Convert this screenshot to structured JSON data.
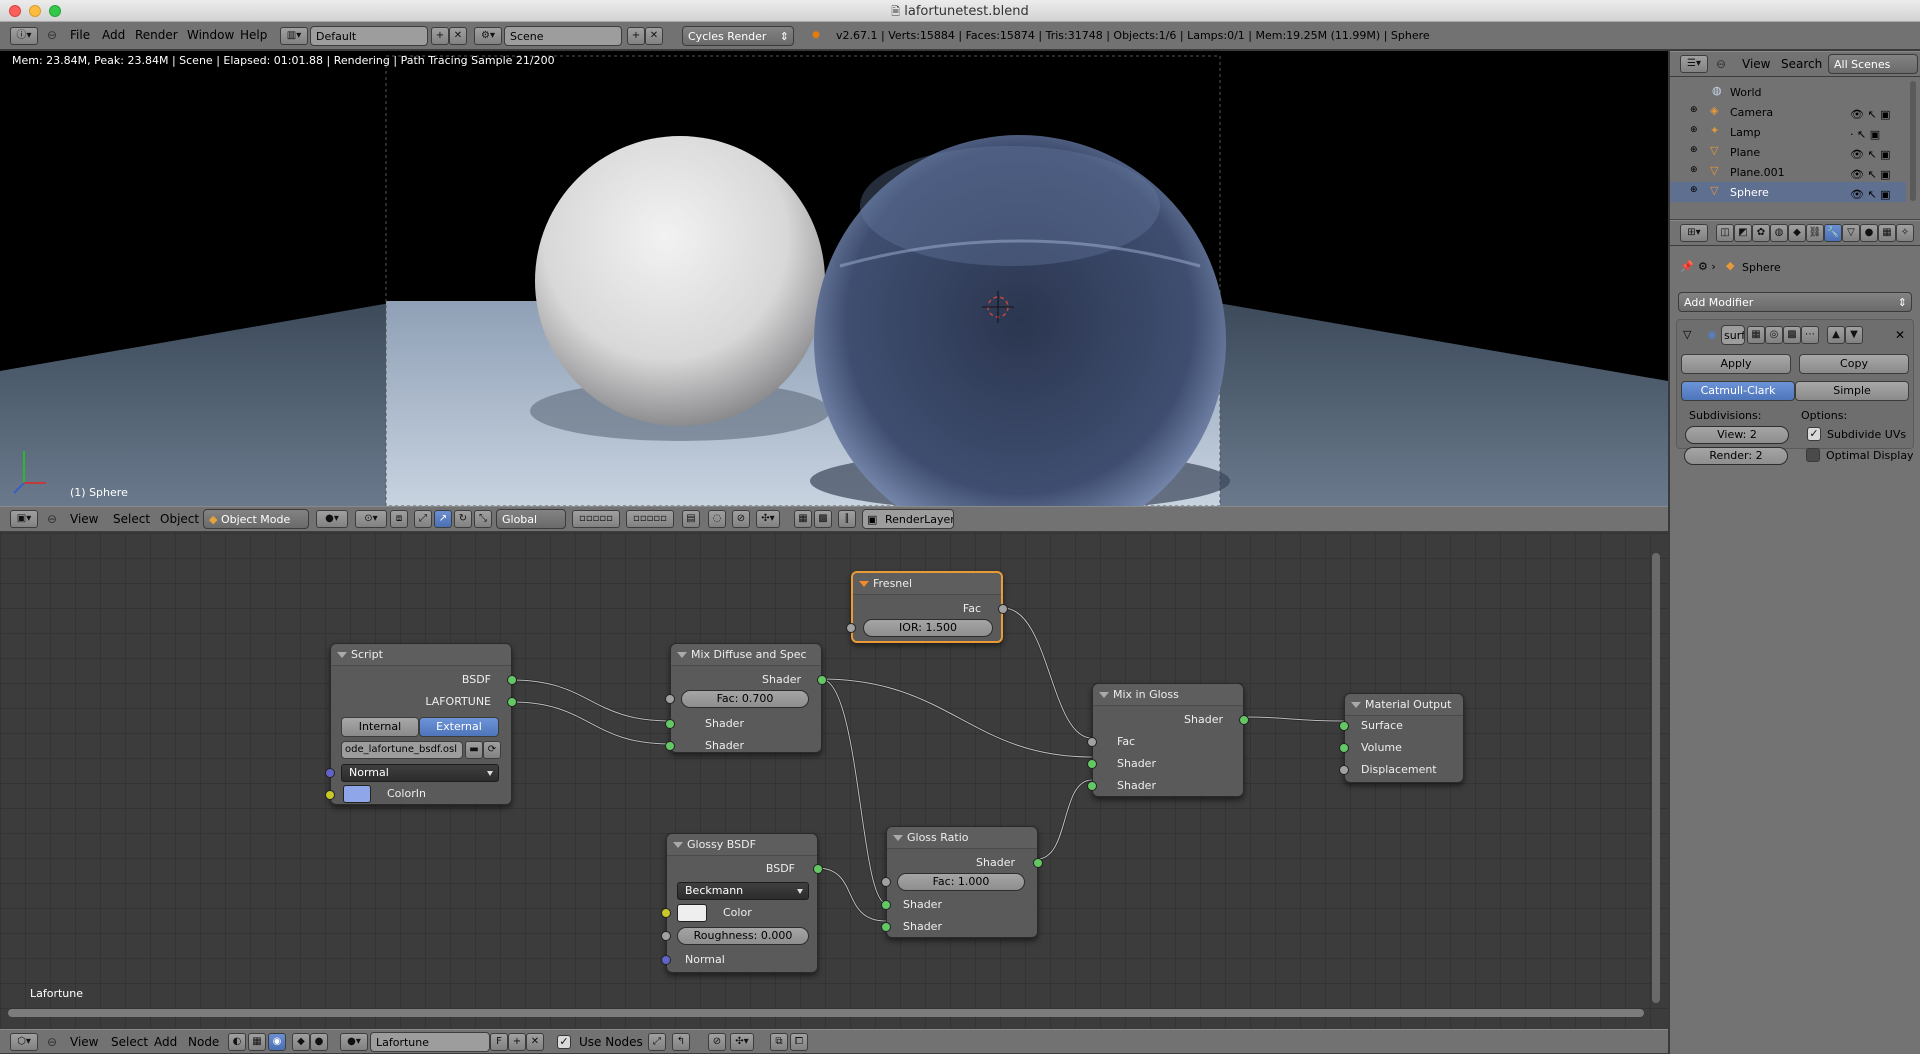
{
  "window": {
    "title": "lafortunetest.blend"
  },
  "info_bar": {
    "menus": [
      "File",
      "Add",
      "Render",
      "Window",
      "Help"
    ],
    "screen_layout": "Default",
    "scene": "Scene",
    "render_engine": "Cycles Render",
    "stats": "v2.67.1 | Verts:15884 | Faces:15874 | Tris:31748 | Objects:1/6 | Lamps:0/1 | Mem:19.25M (11.99M) | Sphere"
  },
  "viewport": {
    "render_status": "Mem: 23.84M, Peak: 23.84M | Scene | Elapsed: 01:01.88 | Rendering | Path Tracing Sample 21/200",
    "object_label": "(1) Sphere",
    "header": {
      "menus": [
        "View",
        "Select",
        "Object"
      ],
      "mode": "Object Mode",
      "orientation": "Global",
      "render_layer": "RenderLayer"
    }
  },
  "outliner": {
    "header": {
      "view": "View",
      "search": "Search",
      "scenes": "All Scenes"
    },
    "items": [
      {
        "name": "World",
        "icon": "world-icon"
      },
      {
        "name": "Camera",
        "icon": "camera-icon"
      },
      {
        "name": "Lamp",
        "icon": "lamp-icon"
      },
      {
        "name": "Plane",
        "icon": "mesh-icon"
      },
      {
        "name": "Plane.001",
        "icon": "mesh-icon"
      },
      {
        "name": "Sphere",
        "icon": "mesh-icon",
        "selected": true
      }
    ]
  },
  "properties": {
    "breadcrumb_object": "Sphere",
    "add_modifier": "Add Modifier",
    "modifier_name": "surf",
    "apply_label": "Apply",
    "copy_label": "Copy",
    "type_catmull": "Catmull-Clark",
    "type_simple": "Simple",
    "subdivisions_label": "Subdivisions:",
    "options_label": "Options:",
    "view_levels": "View: 2",
    "render_levels": "Render: 2",
    "subdivide_uvs": "Subdivide UVs",
    "subdivide_uvs_checked": true,
    "optimal_display": "Optimal Display",
    "optimal_display_checked": false
  },
  "node_editor": {
    "tree_label": "Lafortune",
    "nodes": {
      "script": {
        "title": "Script",
        "out1": "BSDF",
        "out2": "LAFORTUNE",
        "internal": "Internal",
        "external": "External",
        "filepath": "ode_lafortune_bsdf.osl",
        "normal": "Normal",
        "colorin": "ColorIn",
        "color": "#8fa6e8"
      },
      "fresnel": {
        "title": "Fresnel",
        "out": "Fac",
        "ior": "IOR: 1.500"
      },
      "mix_diffuse": {
        "title": "Mix Diffuse and Spec",
        "out": "Shader",
        "fac": "Fac: 0.700",
        "in1": "Shader",
        "in2": "Shader"
      },
      "mix_gloss": {
        "title": "Mix in Gloss",
        "out": "Shader",
        "in_fac": "Fac",
        "in1": "Shader",
        "in2": "Shader"
      },
      "material_output": {
        "title": "Material Output",
        "surface": "Surface",
        "volume": "Volume",
        "displacement": "Displacement"
      },
      "glossy": {
        "title": "Glossy BSDF",
        "out": "BSDF",
        "distribution": "Beckmann",
        "color": "Color",
        "roughness": "Roughness: 0.000",
        "normal": "Normal"
      },
      "gloss_ratio": {
        "title": "Gloss Ratio",
        "out": "Shader",
        "fac": "Fac: 1.000",
        "in1": "Shader",
        "in2": "Shader"
      }
    },
    "header": {
      "menus": [
        "View",
        "Select",
        "Add",
        "Node"
      ],
      "material": "Lafortune",
      "fake_user": "F",
      "use_nodes": "Use Nodes"
    }
  },
  "colors": {
    "accent": "#5680c2",
    "selected_node_border": "#e89b36",
    "socket_shader": "#63c763",
    "socket_color": "#c7c729",
    "socket_vector": "#6363c7",
    "socket_float": "#a1a1a1"
  }
}
